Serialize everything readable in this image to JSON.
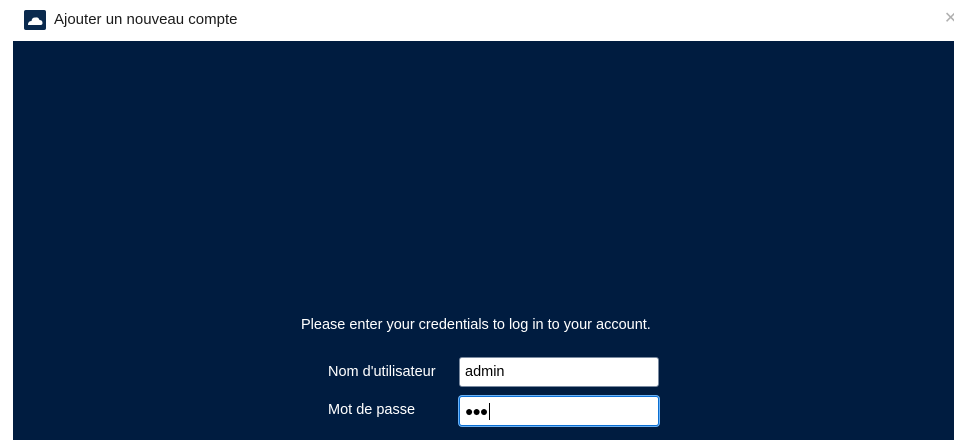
{
  "window": {
    "title": "Ajouter un nouveau compte",
    "close_glyph": "✕",
    "app_icon": "cloud-icon"
  },
  "colors": {
    "content_background": "#001c40",
    "text": "#ffffff",
    "focus_border": "#0a6ed1"
  },
  "login": {
    "instructions": "Please enter your credentials to log in to your account.",
    "username_label": "Nom d'utilisateur",
    "username_value": "admin",
    "password_label": "Mot de passe",
    "password_mask": "●●●"
  }
}
